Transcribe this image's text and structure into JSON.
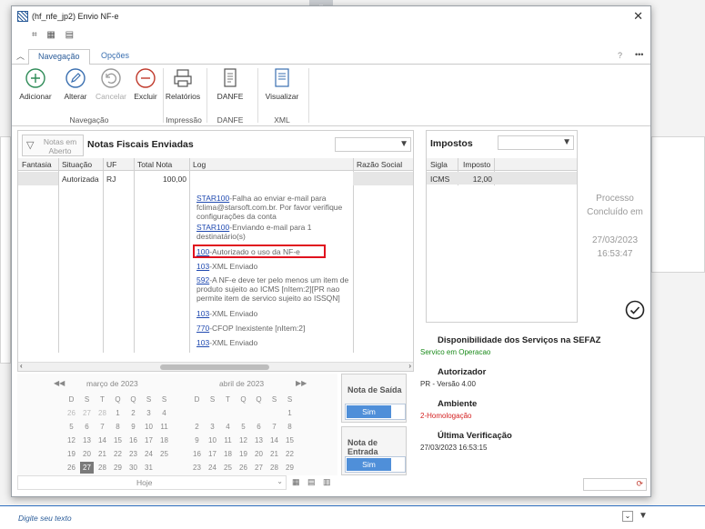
{
  "window": {
    "title": "(hf_nfe_jp2) Envio NF-e"
  },
  "ribbon": {
    "tabs": [
      {
        "label": "Navegação"
      },
      {
        "label": "Opções"
      }
    ],
    "help": "?",
    "more": "•••",
    "buttons": {
      "adicionar": "Adicionar",
      "alterar": "Alterar",
      "cancelar": "Cancelar",
      "excluir": "Excluir",
      "relatorios": "Relatórios",
      "danfe": "DANFE",
      "visualizar": "Visualizar"
    },
    "groups": {
      "navegacao": "Navegação",
      "impressao": "Impressão",
      "danfe": "DANFE",
      "xml": "XML"
    }
  },
  "notas": {
    "filter_label": "Notas em Aberto",
    "title": "Notas Fiscais Enviadas",
    "columns": [
      "Fantasia",
      "Situação",
      "UF",
      "Total Nota",
      "Log",
      "Razão Social"
    ],
    "row": {
      "situacao": "Autorizada",
      "uf": "RJ",
      "total": "100,00"
    },
    "log": [
      {
        "code": "STAR100",
        "text": "-Falha ao enviar e-mail para fclima@starsoft.com.br. Por favor verifique configurações da conta"
      },
      {
        "code": "STAR100",
        "text": "-Enviando e-mail para 1 destinatário(s)"
      },
      {
        "code": "100",
        "text": "-Autorizado o uso da NF-e"
      },
      {
        "code": "103",
        "text": "-XML Enviado"
      },
      {
        "code": "592",
        "text": "-A NF-e deve ter pelo menos um item de produto sujeito ao ICMS [nItem:2][PR nao permite item de servico sujeito ao ISSQN]"
      },
      {
        "code": "103",
        "text": "-XML Enviado"
      },
      {
        "code": "770",
        "text": "-CFOP Inexistente [nItem:2]"
      },
      {
        "code": "103",
        "text": "-XML Enviado"
      }
    ]
  },
  "impostos": {
    "title": "Impostos",
    "columns": [
      "Sigla",
      "Imposto"
    ],
    "row": {
      "sigla": "ICMS",
      "imposto": "12,00"
    }
  },
  "processo": {
    "status": "Processo Concluído em",
    "date": "27/03/2023",
    "time": "16:53:47"
  },
  "calendar": {
    "month1": "março de 2023",
    "month2": "abril de 2023",
    "weekdays": [
      "D",
      "S",
      "T",
      "Q",
      "Q",
      "S",
      "S"
    ],
    "m1": [
      [
        "26",
        "27",
        "28",
        "1",
        "2",
        "3",
        "4"
      ],
      [
        "5",
        "6",
        "7",
        "8",
        "9",
        "10",
        "11"
      ],
      [
        "12",
        "13",
        "14",
        "15",
        "16",
        "17",
        "18"
      ],
      [
        "19",
        "20",
        "21",
        "22",
        "23",
        "24",
        "25"
      ],
      [
        "26",
        "27",
        "28",
        "29",
        "30",
        "31",
        ""
      ]
    ],
    "m2": [
      [
        "",
        "",
        "",
        "",
        "",
        "",
        "1"
      ],
      [
        "2",
        "3",
        "4",
        "5",
        "6",
        "7",
        "8"
      ],
      [
        "9",
        "10",
        "11",
        "12",
        "13",
        "14",
        "15"
      ],
      [
        "16",
        "17",
        "18",
        "19",
        "20",
        "21",
        "22"
      ],
      [
        "23",
        "24",
        "25",
        "26",
        "27",
        "28",
        "29"
      ]
    ],
    "today_label": "Hoje"
  },
  "nota_saida": {
    "label": "Nota de Saída",
    "value": "Sim"
  },
  "nota_entrada": {
    "label": "Nota de Entrada",
    "value": "Sim"
  },
  "servicos": {
    "title": "Disponibilidade dos Serviços na SEFAZ",
    "status": "Servico em Operacao",
    "autorizador_label": "Autorizador",
    "autorizador": "PR - Versão 4.00",
    "ambiente_label": "Ambiente",
    "ambiente": "2-Homologação",
    "ultima_label": "Última Verificação",
    "ultima": "27/03/2023 16:53:15"
  },
  "status_bar": {
    "placeholder": "Digite seu texto"
  },
  "colors": {
    "accent": "#4f8fd9",
    "link": "#1f49b0",
    "green": "#1a8a1a",
    "red": "#d42020",
    "highlight": "#e0121e"
  }
}
